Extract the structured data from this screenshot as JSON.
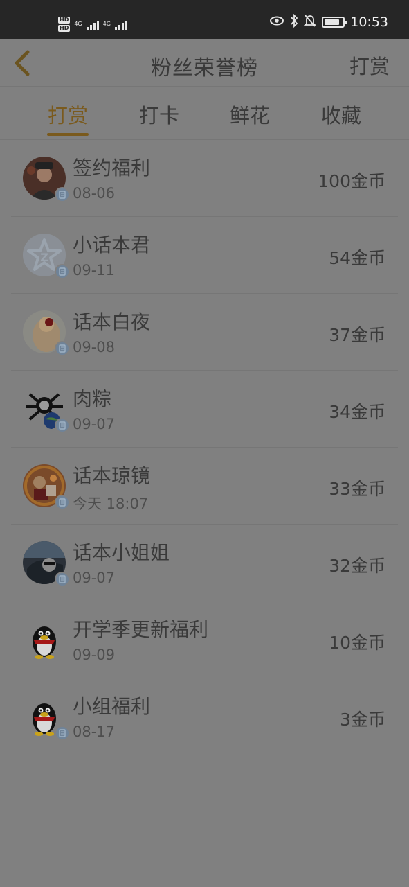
{
  "status_bar": {
    "hd_top": "HD",
    "hd_bottom": "HD",
    "net_1": "4G",
    "net_2": "4G",
    "time": "10:53",
    "battery_level": 0.85
  },
  "header": {
    "title": "粉丝荣誉榜",
    "right_action": "打赏"
  },
  "tabs": [
    {
      "label": "打赏",
      "active": true
    },
    {
      "label": "打卡",
      "active": false
    },
    {
      "label": "鲜花",
      "active": false
    },
    {
      "label": "收藏",
      "active": false
    }
  ],
  "list": [
    {
      "name": "签约福利",
      "date": "08-06",
      "amount": "100金币",
      "avatar": "photo-avatar",
      "badge": true
    },
    {
      "name": "小话本君",
      "date": "09-11",
      "amount": "54金币",
      "avatar": "star-logo-avatar",
      "badge": true
    },
    {
      "name": "话本白夜",
      "date": "09-08",
      "amount": "37金币",
      "avatar": "flower-photo-avatar",
      "badge": true
    },
    {
      "name": "肉粽",
      "date": "09-07",
      "amount": "34金币",
      "avatar": "spider-cartoon-avatar",
      "badge": true
    },
    {
      "name": "话本琼镜",
      "date": "今天 18:07",
      "amount": "33金币",
      "avatar": "illustration-avatar",
      "badge": true
    },
    {
      "name": "话本小姐姐",
      "date": "09-07",
      "amount": "32金币",
      "avatar": "car-photo-avatar",
      "badge": true
    },
    {
      "name": "开学季更新福利",
      "date": "09-09",
      "amount": "10金币",
      "avatar": "penguin-avatar",
      "badge": false
    },
    {
      "name": "小组福利",
      "date": "08-17",
      "amount": "3金币",
      "avatar": "penguin-avatar",
      "badge": true
    }
  ],
  "colors": {
    "accent": "#7a5a1d",
    "overlay_background": "#808080",
    "status_bar": "#262626"
  }
}
